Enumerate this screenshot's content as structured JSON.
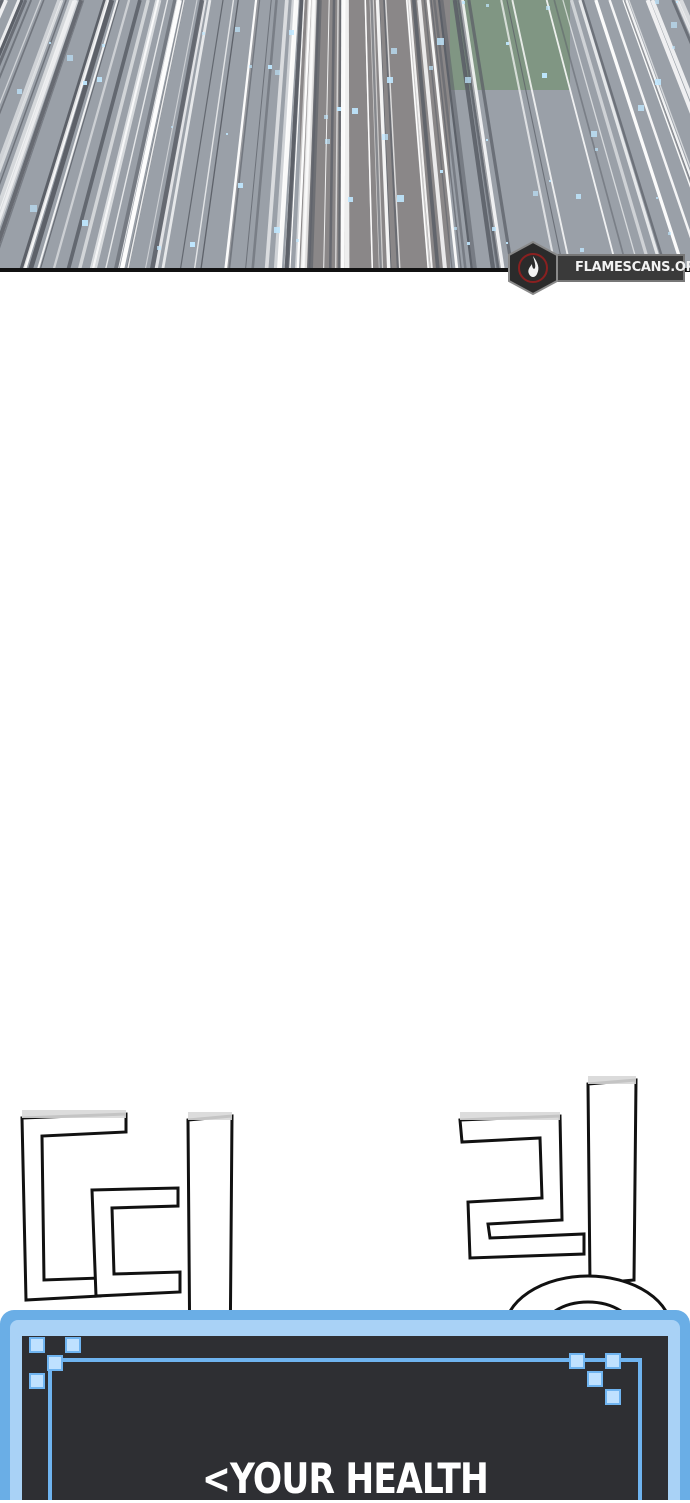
{
  "watermark": {
    "text": "FLAMESCANS.ORG",
    "icon": "flame-icon"
  },
  "sfx": {
    "text": "띠링"
  },
  "status_window": {
    "title": "<YOUR HEALTH"
  },
  "colors": {
    "window_blue": "#6aaee6",
    "window_light": "#a9d2f6",
    "window_dark": "#2e2f33",
    "watermark_plate": "#3a3a3a"
  }
}
